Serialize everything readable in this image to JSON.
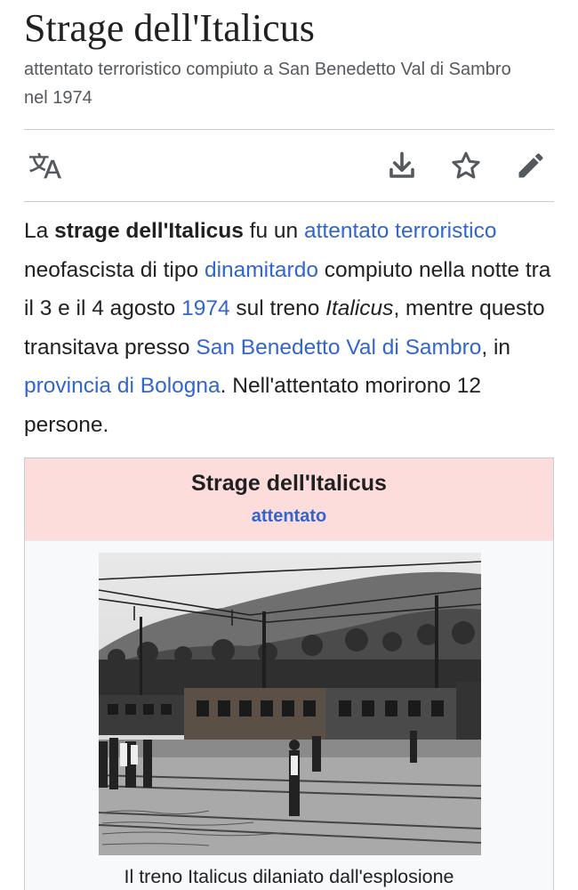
{
  "article": {
    "title": "Strage dell'Italicus",
    "description": "attentato terroristico compiuto a San Benedetto Val di Sambro nel 1974"
  },
  "toolbar": {
    "language": "language-icon",
    "download": "download-icon",
    "watch": "star-icon",
    "edit": "pencil-icon"
  },
  "lead": {
    "p1": "La ",
    "b1": "strage dell'Italicus",
    "p2": " fu un ",
    "a1": "attentato terroristico",
    "p3": " neofascista di tipo ",
    "a2": "dinamitardo",
    "p4": " compiuto nella notte tra il 3 e il 4 agosto ",
    "a3": "1974",
    "p5": " sul treno ",
    "i1": "Italicus",
    "p6": ", mentre questo transitava presso ",
    "a4": "San Benedetto Val di Sambro",
    "p7": ", in ",
    "a5": "provincia di Bologna",
    "p8": ". Nell'attentato morirono 12 persone."
  },
  "infobox": {
    "title": "Strage dell'Italicus",
    "subtitle": "attentato",
    "image": "burned-train-photo",
    "caption": "Il treno Italicus dilaniato dall'esplosione"
  },
  "colors": {
    "link": "#3366cc",
    "infobox_header": "#fddcdc",
    "text": "#202122",
    "muted": "#54595d"
  }
}
